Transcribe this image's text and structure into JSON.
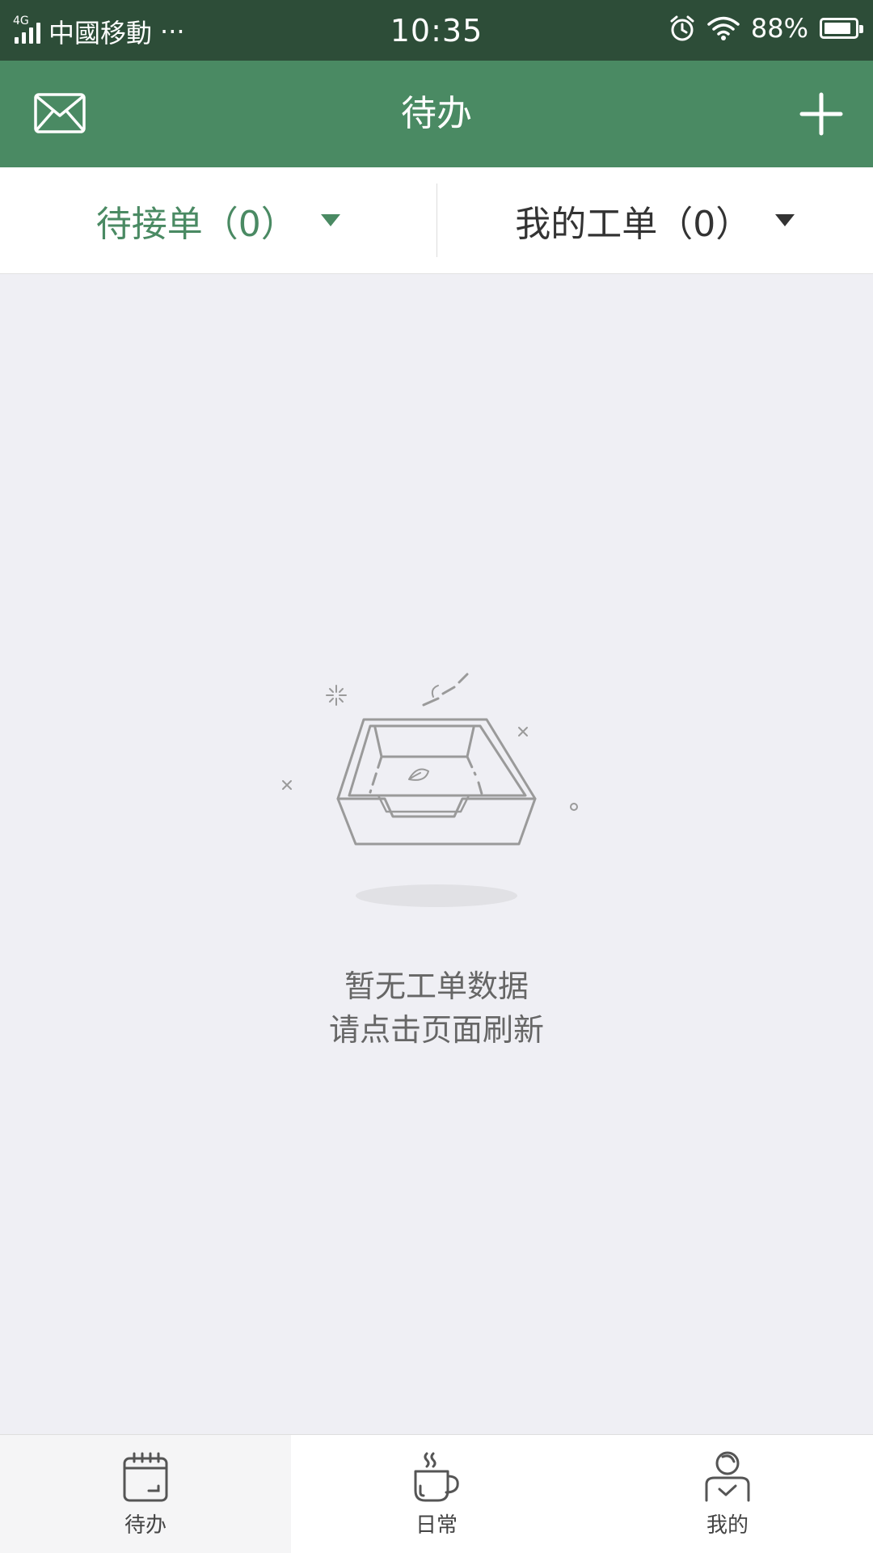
{
  "status_bar": {
    "network_type": "4G",
    "carrier": "中國移動",
    "more": "···",
    "time": "10:35",
    "battery_percent": "88%",
    "battery_level": 0.88,
    "icons": [
      "signal-icon",
      "alarm-icon",
      "wifi-icon",
      "battery-icon"
    ]
  },
  "header": {
    "title": "待办",
    "left_icon": "mail-icon",
    "right_icon": "plus-icon",
    "background": "#4a8a63"
  },
  "filters": [
    {
      "label": "待接单（0）",
      "active": true
    },
    {
      "label": "我的工单（0）",
      "active": false
    }
  ],
  "empty_state": {
    "illustration": "empty-tray-icon",
    "line1": "暂无工单数据",
    "line2": "请点击页面刷新"
  },
  "tabbar": [
    {
      "label": "待办",
      "icon": "calendar-icon",
      "selected": true
    },
    {
      "label": "日常",
      "icon": "coffee-cup-icon",
      "selected": false
    },
    {
      "label": "我的",
      "icon": "user-icon",
      "selected": false
    }
  ],
  "colors": {
    "accent": "#4a8a63",
    "status_bar": "#2d4d38",
    "page_bg": "#efeff4"
  }
}
